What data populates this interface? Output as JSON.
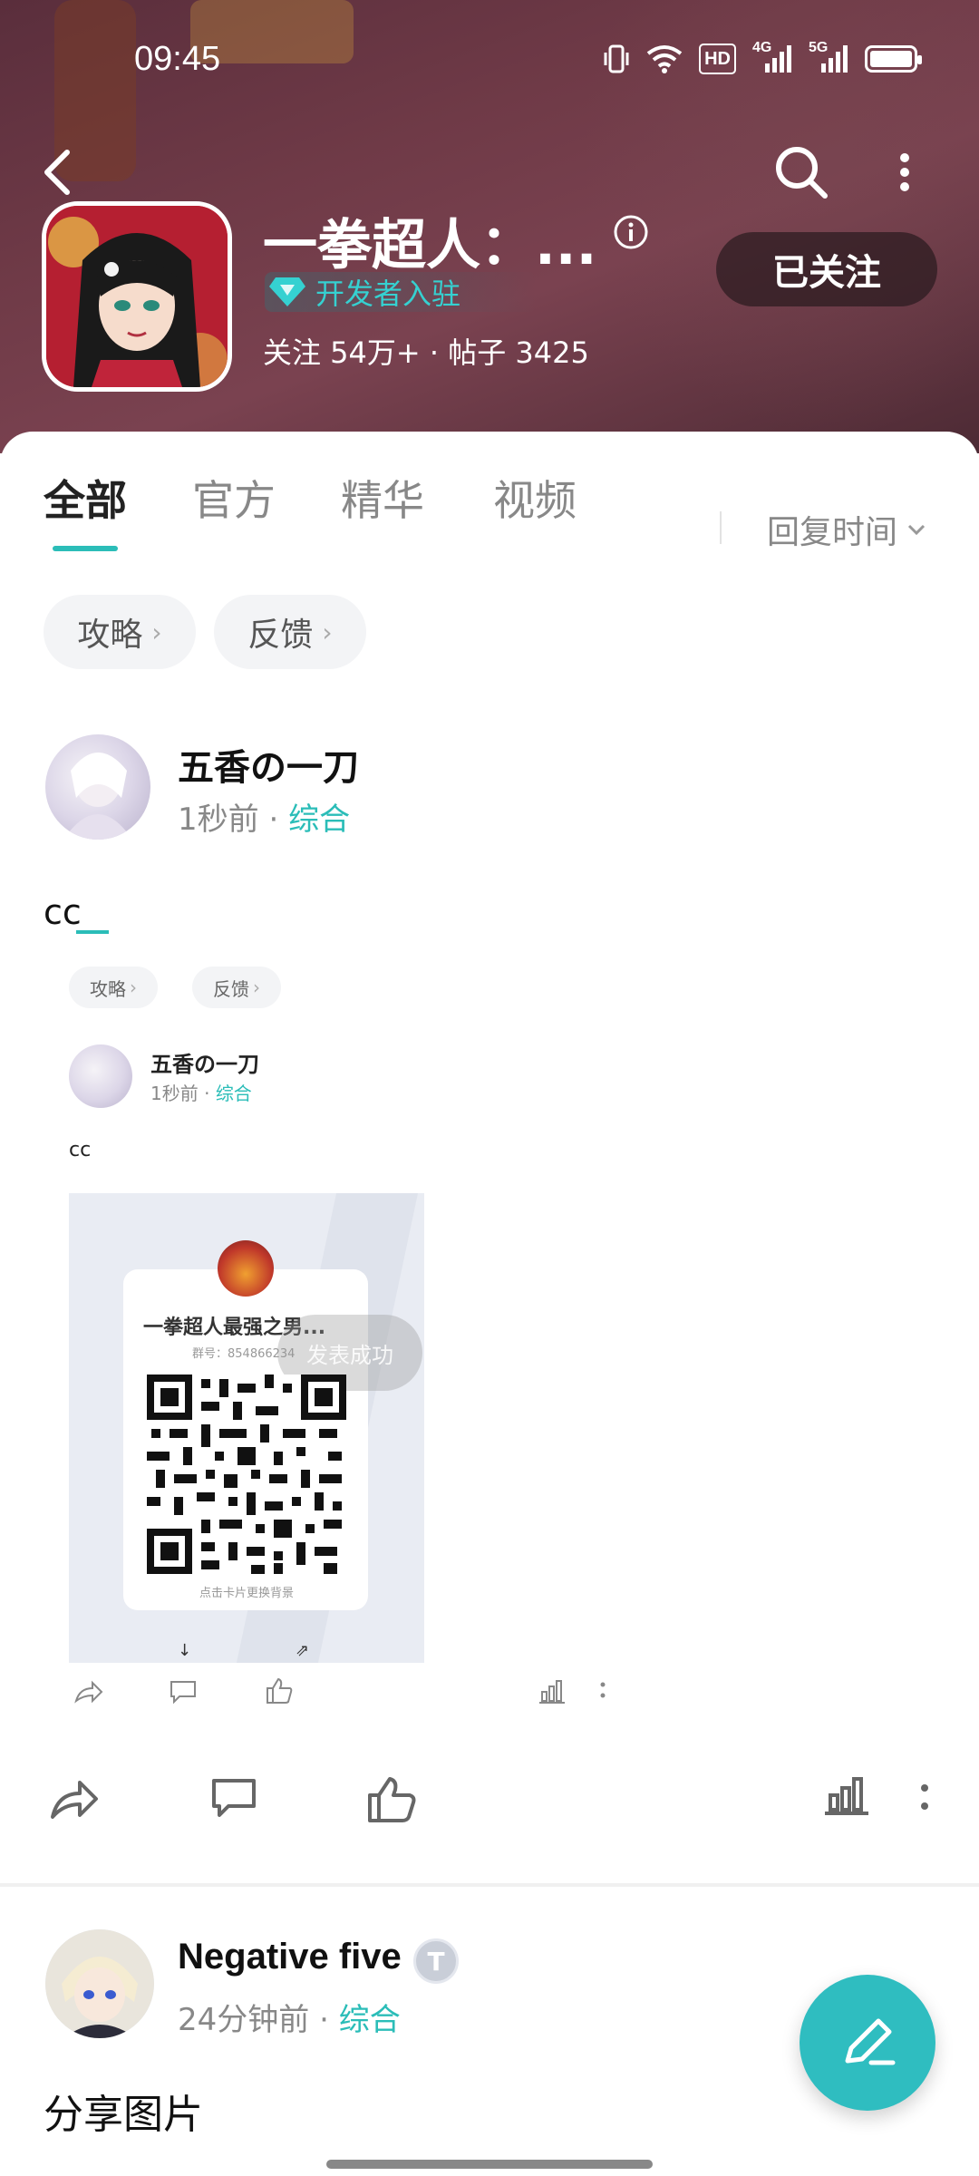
{
  "status_bar": {
    "time": "09:45",
    "hd_label": "HD",
    "net_4g": "4G",
    "net_5g": "5G"
  },
  "header": {
    "title": "一拳超人：...",
    "developer_badge": "开发者入驻",
    "stats": "关注 54万+ · 帖子 3425",
    "follow_button": "已关注"
  },
  "tabs": [
    "全部",
    "官方",
    "精华",
    "视频"
  ],
  "sort_label": "回复时间",
  "chips": [
    "攻略",
    "反馈"
  ],
  "posts": [
    {
      "author": "五香の一刀",
      "time": "1秒前",
      "category": "综合",
      "text": "cc"
    },
    {
      "author": "Negative five",
      "time": "24分钟前",
      "category": "综合",
      "text": "分享图片",
      "level_badge": "T"
    }
  ],
  "embedded_screenshot": {
    "chips": [
      "攻略",
      "反馈"
    ],
    "author": "五香の一刀",
    "time": "1秒前",
    "category": "综合",
    "text": "cc",
    "qr_card": {
      "group_name": "一拳超人最强之男...",
      "group_number": "群号：854866234",
      "toast": "发表成功",
      "footer": "点击卡片更换背景"
    }
  },
  "colors": {
    "accent": "#2bbdb8",
    "header_bg": "#6f3a47",
    "fab": "#2fbdc0"
  },
  "icons": [
    "back-icon",
    "search-icon",
    "more-vertical-icon",
    "info-icon",
    "diamond-icon",
    "share-icon",
    "comment-icon",
    "like-icon",
    "stats-icon",
    "edit-pen-icon"
  ]
}
